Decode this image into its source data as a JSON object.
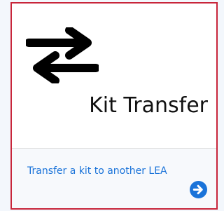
{
  "card": {
    "title": "Kit Transfer",
    "link_text": "Transfer a kit to another LEA",
    "main_icon": "swap-arrows-icon",
    "action_icon": "arrow-right-circle-icon",
    "colors": {
      "border": "#c8253a",
      "link": "#1a73d9",
      "action_icon": "#1a73d9"
    }
  }
}
